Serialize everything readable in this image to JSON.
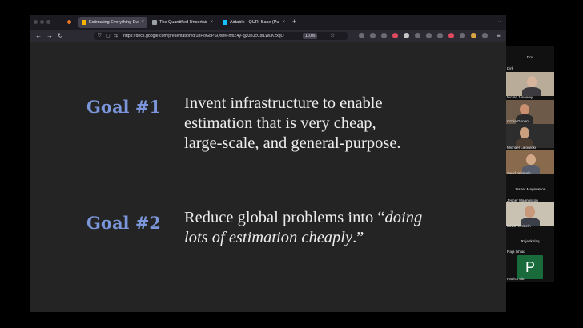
{
  "browser": {
    "tabs": [
      {
        "label": "Estimating Everything Everywhe",
        "active": true,
        "favicon_color": "#f4b400"
      },
      {
        "label": "The Quantified Uncertainty Res",
        "active": false,
        "favicon_color": "#9aa0a6"
      },
      {
        "label": "Airtable - QURI Base (Public)",
        "active": false,
        "favicon_color": "#18bfff"
      }
    ],
    "close_glyph": "×",
    "new_tab_glyph": "+",
    "url": "https://docs.google.com/presentation/d/1hHoGdPSOxhK-hniZ4y-qjz0BJcCsfLWLKzxqO",
    "zoom": "110%",
    "icons": {
      "back": "←",
      "forward": "→",
      "reload": "↻",
      "shield": "⛉",
      "tracking": "⇆",
      "star": "☆",
      "menu": "≡",
      "chevron": "⌄"
    },
    "extension_colors": [
      "#6b6b75",
      "#6b6b75",
      "#6b6b75",
      "#e04a5f",
      "#c7c7c7",
      "#6b6b75",
      "#6b6b75",
      "#6b6b75",
      "#e04a5f",
      "#6b6b75",
      "#d9a441",
      "#6b6b75"
    ]
  },
  "slide": {
    "goal1": {
      "label": "Goal #1",
      "lines": [
        "Invent infrastructure to enable",
        "estimation that is very cheap,",
        "large-scale, and general-purpose."
      ]
    },
    "goal2": {
      "label": "Goal #2",
      "line1_plain": "Reduce global problems into “",
      "line1_italic": "doing",
      "line2_italic": "lots of estimation cheaply",
      "line2_plain": ".”"
    }
  },
  "participants": [
    {
      "name": "Dov",
      "has_video": false
    },
    {
      "name": "Dirk",
      "has_video": false
    },
    {
      "name": "Nicole Janeway",
      "has_video": true
    },
    {
      "name": "Ozzie Gooen",
      "has_video": true
    },
    {
      "name": "Michael Latowicki",
      "has_video": true
    },
    {
      "name": "david reinstein",
      "has_video": true
    },
    {
      "name": "Jesper Magnusson",
      "has_video": false
    },
    {
      "name": "david reinstein",
      "has_video": true
    },
    {
      "name": "Raja Ikhlaq",
      "has_video": false
    },
    {
      "name": "Patrick Liu",
      "has_video": false,
      "avatar_initial": "P",
      "avatar_color": "#1a6b3c"
    }
  ]
}
